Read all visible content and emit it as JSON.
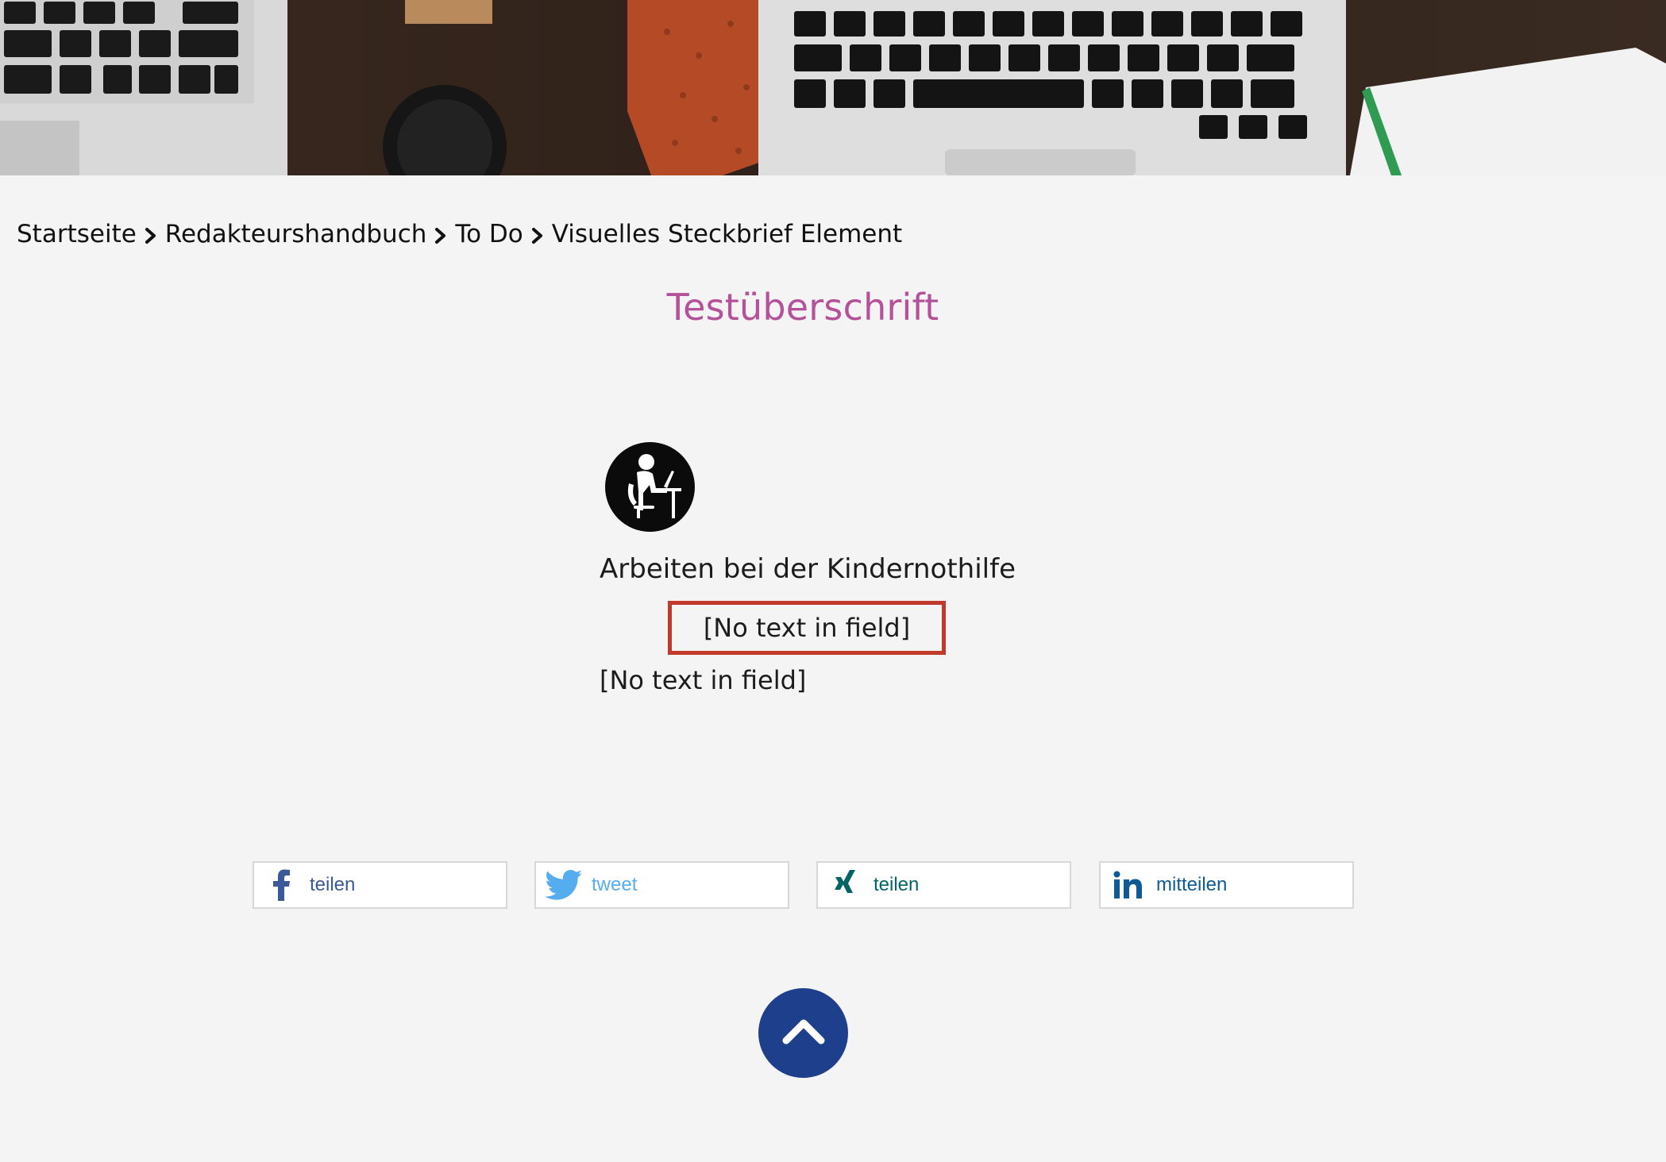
{
  "breadcrumb": {
    "items": [
      "Startseite",
      "Redakteurshandbuch",
      "To Do",
      "Visuelles Steckbrief Element"
    ]
  },
  "page": {
    "title": "Testüberschrift"
  },
  "profile": {
    "icon": "person-at-laptop-icon",
    "heading": "Arbeiten bei der Kindernothilfe",
    "field_boxed": "[No text in field]",
    "field_plain": "[No text in field]"
  },
  "share": [
    {
      "network": "facebook",
      "label": "teilen",
      "color": "#3b5998"
    },
    {
      "network": "twitter",
      "label": "tweet",
      "color": "#55acee"
    },
    {
      "network": "xing",
      "label": "teilen",
      "color": "#026466"
    },
    {
      "network": "linkedin",
      "label": "mitteilen",
      "color": "#0e5a96"
    }
  ],
  "colors": {
    "title": "#b5519a",
    "back_to_top": "#1d3f8c",
    "highlight_border": "#c0392b"
  },
  "back_to_top": {
    "icon": "chevron-up-icon"
  }
}
